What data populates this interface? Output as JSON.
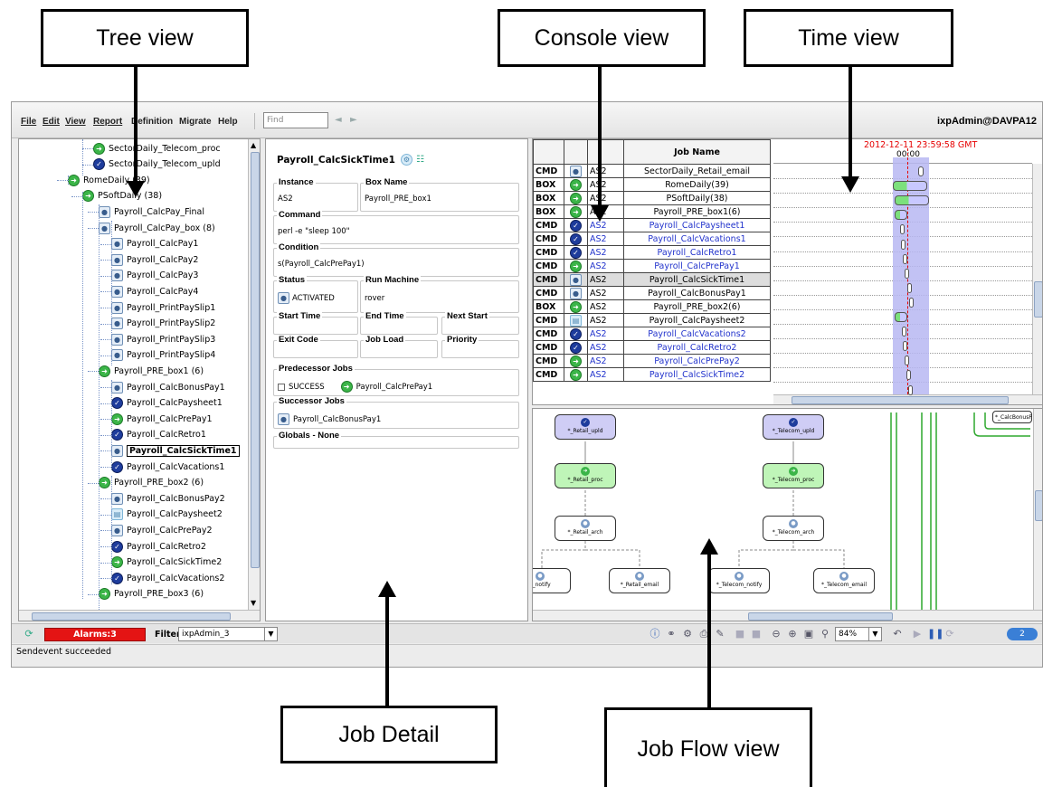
{
  "callouts": {
    "tree_view": "Tree view",
    "console_view": "Console view",
    "time_view": "Time view",
    "job_detail": "Job Detail",
    "job_flow_view": "Job Flow view"
  },
  "menubar": {
    "items": [
      "File",
      "Edit",
      "View",
      "Report",
      "Definition",
      "Migrate",
      "Help"
    ],
    "find_placeholder": "Find",
    "user": "ixpAdmin@DAVPA12"
  },
  "tree": {
    "nodes": [
      {
        "label": "SectorDaily_Telecom_proc",
        "icon": "green-arrow"
      },
      {
        "label": "SectorDaily_Telecom_upld",
        "icon": "blue-check"
      },
      {
        "label": "RomeDaily (39)",
        "icon": "green-arrow"
      },
      {
        "label": "PSoftDaily (38)",
        "icon": "green-arrow"
      },
      {
        "label": "Payroll_CalcPay_Final",
        "icon": "job-doc"
      },
      {
        "label": "Payroll_CalcPay_box (8)",
        "icon": "job-doc"
      },
      {
        "label": "Payroll_CalcPay1",
        "icon": "job-doc"
      },
      {
        "label": "Payroll_CalcPay2",
        "icon": "job-doc"
      },
      {
        "label": "Payroll_CalcPay3",
        "icon": "job-doc"
      },
      {
        "label": "Payroll_CalcPay4",
        "icon": "job-doc"
      },
      {
        "label": "Payroll_PrintPaySlip1",
        "icon": "job-doc"
      },
      {
        "label": "Payroll_PrintPaySlip2",
        "icon": "job-doc"
      },
      {
        "label": "Payroll_PrintPaySlip3",
        "icon": "job-doc"
      },
      {
        "label": "Payroll_PrintPaySlip4",
        "icon": "job-doc"
      },
      {
        "label": "Payroll_PRE_box1 (6)",
        "icon": "green-arrow"
      },
      {
        "label": "Payroll_CalcBonusPay1",
        "icon": "job-doc"
      },
      {
        "label": "Payroll_CalcPaysheet1",
        "icon": "blue-check"
      },
      {
        "label": "Payroll_CalcPrePay1",
        "icon": "green-arrow"
      },
      {
        "label": "Payroll_CalcRetro1",
        "icon": "blue-check"
      },
      {
        "label": "Payroll_CalcSickTime1",
        "icon": "job-doc"
      },
      {
        "label": "Payroll_CalcVacations1",
        "icon": "blue-check"
      },
      {
        "label": "Payroll_PRE_box2 (6)",
        "icon": "green-arrow"
      },
      {
        "label": "Payroll_CalcBonusPay2",
        "icon": "job-doc"
      },
      {
        "label": "Payroll_CalcPaysheet2",
        "icon": "job-light"
      },
      {
        "label": "Payroll_CalcPrePay2",
        "icon": "job-doc"
      },
      {
        "label": "Payroll_CalcRetro2",
        "icon": "blue-check"
      },
      {
        "label": "Payroll_CalcSickTime2",
        "icon": "green-arrow"
      },
      {
        "label": "Payroll_CalcVacations2",
        "icon": "blue-check"
      },
      {
        "label": "Payroll_PRE_box3 (6)",
        "icon": "green-arrow"
      }
    ]
  },
  "detail": {
    "title": "Payroll_CalcSickTime1",
    "instance_label": "Instance",
    "instance_value": "AS2",
    "box_label": "Box Name",
    "box_value": "Payroll_PRE_box1",
    "command_label": "Command",
    "command_value": "perl -e \"sleep 100\"",
    "condition_label": "Condition",
    "condition_value": "s(Payroll_CalcPrePay1)",
    "status_label": "Status",
    "status_value": "ACTIVATED",
    "machine_label": "Run Machine",
    "machine_value": "rover",
    "start_label": "Start Time",
    "end_label": "End Time",
    "next_label": "Next Start",
    "exit_label": "Exit Code",
    "load_label": "Job Load",
    "priority_label": "Priority",
    "pred_label": "Predecessor Jobs",
    "pred_cond": "SUCCESS",
    "pred_job": "Payroll_CalcPrePay1",
    "succ_label": "Successor Jobs",
    "succ_job": "Payroll_CalcBonusPay1",
    "globals_label": "Globals - None"
  },
  "console": {
    "header_job_name": "Job Name",
    "time_label": "2012-12-11 23:59:58 GMT",
    "time_tick": "00:00",
    "rows": [
      {
        "type": "CMD",
        "status": "job-doc",
        "inst": "AS2",
        "name": "SectorDaily_Retail_email",
        "blue": false
      },
      {
        "type": "BOX",
        "status": "green-arrow",
        "inst": "AS2",
        "name": "RomeDaily(39)",
        "blue": false
      },
      {
        "type": "BOX",
        "status": "green-arrow",
        "inst": "AS2",
        "name": "PSoftDaily(38)",
        "blue": false
      },
      {
        "type": "BOX",
        "status": "green-arrow",
        "inst": "AS2",
        "name": "Payroll_PRE_box1(6)",
        "blue": false
      },
      {
        "type": "CMD",
        "status": "blue-check",
        "inst": "AS2",
        "name": "Payroll_CalcPaysheet1",
        "blue": true
      },
      {
        "type": "CMD",
        "status": "blue-check",
        "inst": "AS2",
        "name": "Payroll_CalcVacations1",
        "blue": true
      },
      {
        "type": "CMD",
        "status": "blue-check",
        "inst": "AS2",
        "name": "Payroll_CalcRetro1",
        "blue": true
      },
      {
        "type": "CMD",
        "status": "green-arrow",
        "inst": "AS2",
        "name": "Payroll_CalcPrePay1",
        "blue": true
      },
      {
        "type": "CMD",
        "status": "job-doc",
        "inst": "AS2",
        "name": "Payroll_CalcSickTime1",
        "blue": false,
        "selected": true
      },
      {
        "type": "CMD",
        "status": "job-doc",
        "inst": "AS2",
        "name": "Payroll_CalcBonusPay1",
        "blue": false
      },
      {
        "type": "BOX",
        "status": "green-arrow",
        "inst": "AS2",
        "name": "Payroll_PRE_box2(6)",
        "blue": false
      },
      {
        "type": "CMD",
        "status": "job-light",
        "inst": "AS2",
        "name": "Payroll_CalcPaysheet2",
        "blue": false
      },
      {
        "type": "CMD",
        "status": "blue-check",
        "inst": "AS2",
        "name": "Payroll_CalcVacations2",
        "blue": true
      },
      {
        "type": "CMD",
        "status": "blue-check",
        "inst": "AS2",
        "name": "Payroll_CalcRetro2",
        "blue": true
      },
      {
        "type": "CMD",
        "status": "green-arrow",
        "inst": "AS2",
        "name": "Payroll_CalcPrePay2",
        "blue": true
      },
      {
        "type": "CMD",
        "status": "green-arrow",
        "inst": "AS2",
        "name": "Payroll_CalcSickTime2",
        "blue": true
      }
    ]
  },
  "flow": {
    "retail_upld": "*_Retail_upld",
    "telecom_upld": "*_Telecom_upld",
    "retail_proc": "*_Retail_proc",
    "telecom_proc": "*_Telecom_proc",
    "retail_arch": "*_Retail_arch",
    "telecom_arch": "*_Telecom_arch",
    "retail_notify": "il_notify",
    "retail_email": "*_Retail_email",
    "telecom_notify": "*_Telecom_notify",
    "telecom_email": "*_Telecom_email",
    "right_node": "*_CalcBonusPa"
  },
  "statusbar": {
    "alarms": "Alarms:3",
    "filter_label": "Filter",
    "filter_value": "ixpAdmin_3",
    "zoom": "84%",
    "badge": "2",
    "message": "Sendevent succeeded"
  },
  "colors": {
    "alarm_red": "#e41414",
    "running_green": "#3bb548",
    "success_blue": "#1e3c9c",
    "time_bar": "#b7b7f2",
    "time_marker": "#e60000"
  }
}
